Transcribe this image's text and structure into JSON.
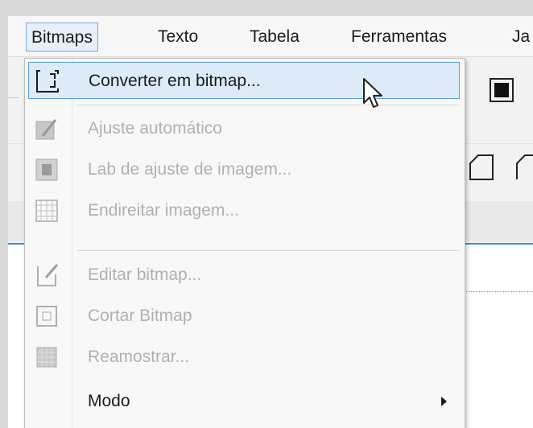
{
  "menubar": {
    "items": [
      {
        "label": "Bitmaps",
        "active": true
      },
      {
        "label": "Texto"
      },
      {
        "label": "Tabela"
      },
      {
        "label": "Ferramentas"
      },
      {
        "label": "Ja"
      }
    ]
  },
  "dropdown": {
    "items": [
      {
        "label": "Converter em bitmap...",
        "icon": "convert-bitmap-icon",
        "enabled": true,
        "highlighted": true
      },
      {
        "label": "Ajuste automático",
        "icon": "auto-adjust-icon",
        "enabled": false
      },
      {
        "label": "Lab de ajuste de imagem...",
        "icon": "image-adjustment-lab-icon",
        "enabled": false
      },
      {
        "label": "Endireitar imagem...",
        "icon": "straighten-image-icon",
        "enabled": false
      },
      {
        "label": "Editar bitmap...",
        "icon": "edit-bitmap-icon",
        "enabled": false
      },
      {
        "label": "Cortar Bitmap",
        "icon": "crop-bitmap-icon",
        "enabled": false
      },
      {
        "label": "Reamostrar...",
        "icon": "resample-icon",
        "enabled": false
      },
      {
        "label": "Modo",
        "icon": "",
        "enabled": true,
        "submenu": true
      }
    ]
  },
  "colors": {
    "highlight_bg": "#dcebf7",
    "highlight_border": "#5aa0dc",
    "disabled_text": "#b0b0b0",
    "accent_line": "#3d8fd6"
  }
}
